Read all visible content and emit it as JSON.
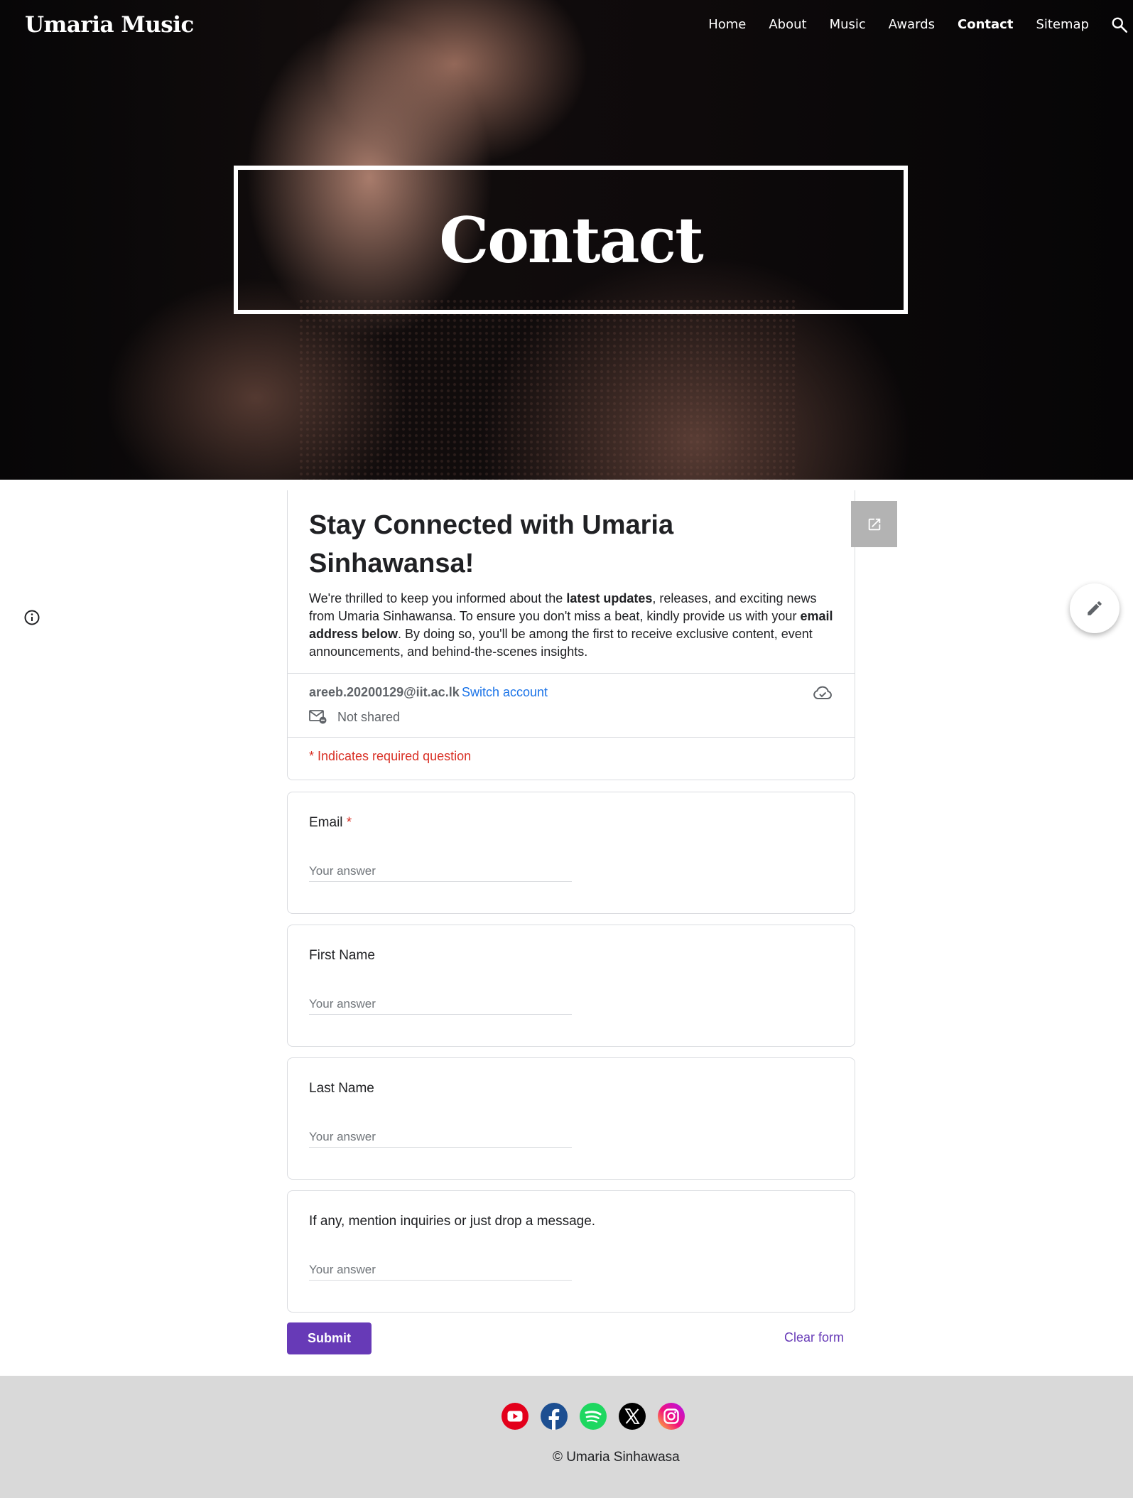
{
  "site": {
    "title": "Umaria Music",
    "nav": [
      "Home",
      "About",
      "Music",
      "Awards",
      "Contact",
      "Sitemap"
    ],
    "active_nav": "Contact",
    "hero_title": "Contact"
  },
  "form": {
    "title": "Stay Connected with Umaria Sinhawansa!",
    "desc_part1": "We're thrilled to keep you informed about the ",
    "desc_bold1": "latest updates",
    "desc_part2": ", releases, and exciting news from Umaria Sinhawansa. To ensure you don't miss a beat, kindly provide us with your ",
    "desc_bold2": "email address below",
    "desc_part3": ". By doing so, you'll be among the first to receive exclusive content, event announcements, and behind-the-scenes insights.",
    "account_email": "areeb.20200129@iit.ac.lk",
    "switch_account": "Switch account",
    "not_shared": "Not shared",
    "required_note": "* Indicates required question",
    "questions": [
      {
        "label": "Email",
        "required_mark": "*",
        "placeholder": "Your answer"
      },
      {
        "label": "First Name",
        "placeholder": "Your answer"
      },
      {
        "label": "Last Name",
        "placeholder": "Your answer"
      },
      {
        "label": "If any, mention inquiries or just drop a message.",
        "placeholder": "Your answer"
      }
    ],
    "submit_label": "Submit",
    "clear_label": "Clear form"
  },
  "footer": {
    "social_icons": [
      "youtube-icon",
      "facebook-icon",
      "spotify-icon",
      "x-twitter-icon",
      "instagram-icon"
    ],
    "copyright": "© Umaria Sinhawasa"
  },
  "colors": {
    "accent": "#673ab7",
    "link": "#1a73e8",
    "required": "#d93025",
    "footer_bg": "#d9d9d9"
  }
}
